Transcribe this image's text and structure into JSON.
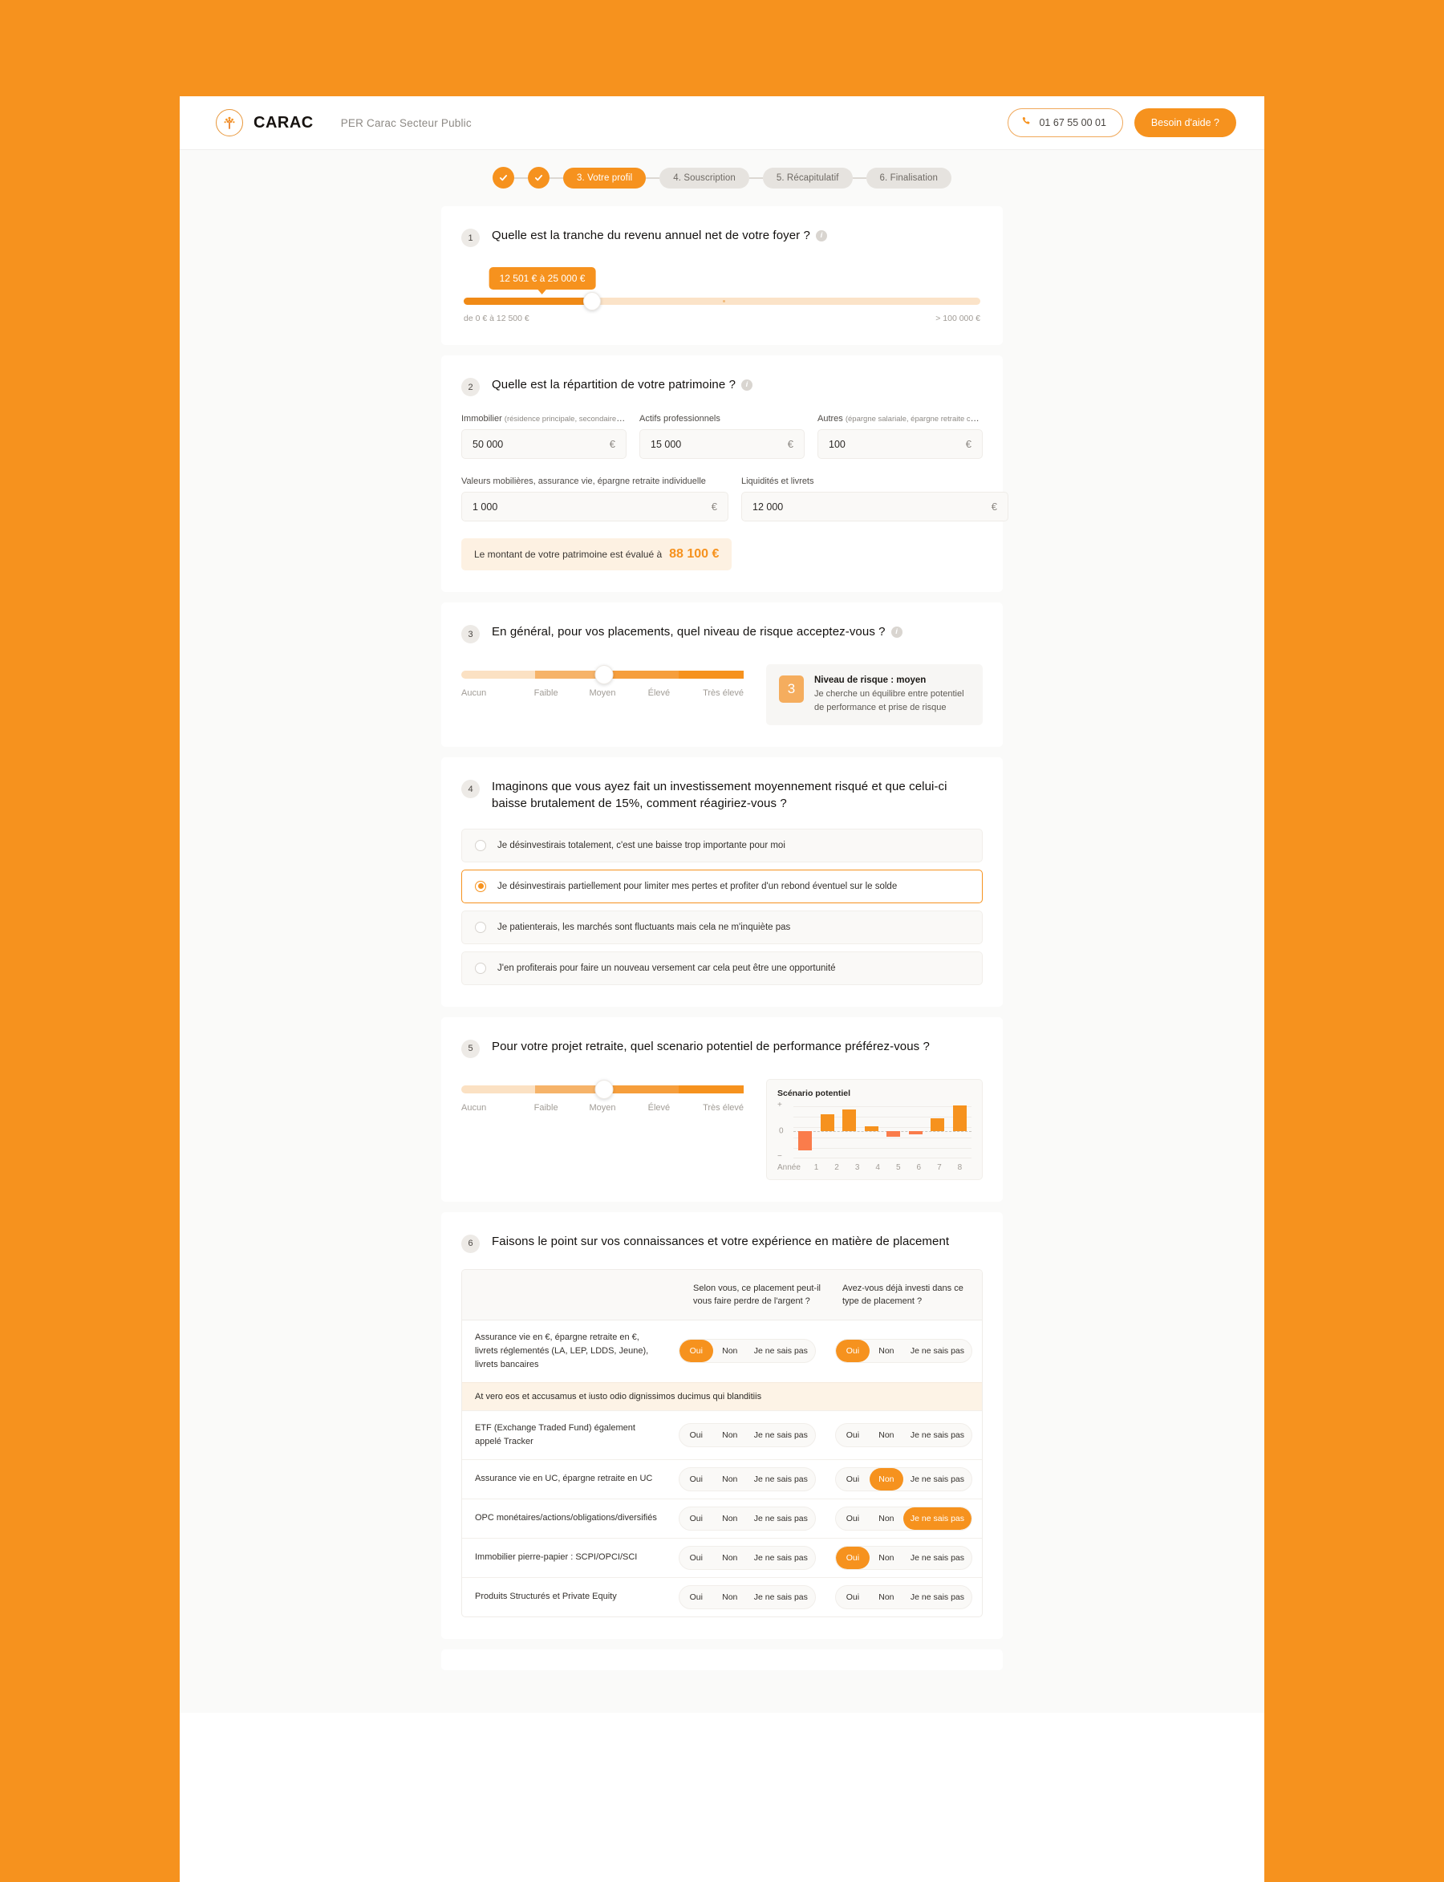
{
  "header": {
    "brand_name": "CARAC",
    "product_name": "PER Carac Secteur Public",
    "phone": "01 67 55 00 01",
    "help_label": "Besoin d'aide ?"
  },
  "stepper": {
    "steps": [
      {
        "label": "",
        "state": "done"
      },
      {
        "label": "",
        "state": "done"
      },
      {
        "label": "3. Votre profil",
        "state": "current"
      },
      {
        "label": "4. Souscription",
        "state": "todo"
      },
      {
        "label": "5. Récapitulatif",
        "state": "todo"
      },
      {
        "label": "6. Finalisation",
        "state": "todo"
      }
    ]
  },
  "q1": {
    "number": "1",
    "text": "Quelle est la tranche du revenu annuel net de votre foyer ?",
    "bubble_value": "12 501 € à 25 000 €",
    "min_label": "de 0 € à 12 500 €",
    "max_label": "> 100 000 €"
  },
  "q2": {
    "number": "2",
    "text": "Quelle est la répartition de votre patrimoine ?",
    "fields": [
      {
        "label": "Immobilier",
        "hint": "(résidence principale, secondaire et locatif)",
        "value": "50 000",
        "unit": "€"
      },
      {
        "label": "Actifs professionnels",
        "hint": "",
        "value": "15 000",
        "unit": "€"
      },
      {
        "label": "Autres",
        "hint": "(épargne salariale, épargne retraite collective...)",
        "value": "100",
        "unit": "€"
      },
      {
        "label": "Valeurs mobilières, assurance vie, épargne retraite individuelle",
        "hint": "",
        "value": "1 000",
        "unit": "€"
      },
      {
        "label": "Liquidités et livrets",
        "hint": "",
        "value": "12 000",
        "unit": "€"
      }
    ],
    "total_prefix": "Le montant de votre patrimoine est évalué à",
    "total_amount": "88 100 €"
  },
  "q3": {
    "number": "3",
    "text": "En général, pour vos placements, quel niveau de risque acceptez-vous ?",
    "scale": [
      "Aucun",
      "Faible",
      "Moyen",
      "Élevé",
      "Très élevé"
    ],
    "badge": "3",
    "info_title": "Niveau de risque : moyen",
    "info_desc": "Je cherche un équilibre entre potentiel de performance et prise de risque"
  },
  "q4": {
    "number": "4",
    "text": "Imaginons que vous ayez fait un investissement moyennement risqué et que celui-ci baisse brutalement de 15%, comment réagiriez-vous ?",
    "options": [
      {
        "label": "Je désinvestirais totalement, c'est une baisse trop importante pour moi",
        "selected": false
      },
      {
        "label": "Je désinvestirais partiellement pour limiter mes pertes et profiter d'un rebond éventuel sur le solde",
        "selected": true
      },
      {
        "label": "Je patienterais, les marchés sont fluctuants mais cela ne m'inquiète pas",
        "selected": false
      },
      {
        "label": "J'en profiterais pour faire un nouveau versement car cela peut être une opportunité",
        "selected": false
      }
    ]
  },
  "q5": {
    "number": "5",
    "text": "Pour votre projet retraite, quel scenario potentiel de performance préférez-vous ?",
    "scale": [
      "Aucun",
      "Faible",
      "Moyen",
      "Élevé",
      "Très élevé"
    ]
  },
  "chart_data": {
    "type": "bar",
    "title": "Scénario potentiel",
    "xlabel": "Année",
    "ylabel": "",
    "categories": [
      "1",
      "2",
      "3",
      "4",
      "5",
      "6",
      "7",
      "8"
    ],
    "values": [
      -28,
      24,
      31,
      7,
      -8,
      -4,
      18,
      37
    ],
    "ylim": [
      -35,
      40
    ],
    "ytick_labels": [
      "+",
      "0",
      "−"
    ],
    "grid": true,
    "legend": "none",
    "colors": {
      "positive": "#F6921E",
      "negative": "#FA7C4B"
    }
  },
  "q6": {
    "number": "6",
    "text": "Faisons le point sur vos connaissances et votre expérience en matière de placement",
    "col1_header": "Selon vous, ce placement peut-il vous faire perdre de l'argent ?",
    "col2_header": "Avez-vous déjà investi dans ce type de placement ?",
    "choices": [
      "Oui",
      "Non",
      "Je ne sais pas"
    ],
    "note": "At vero eos et accusamus et iusto odio dignissimos ducimus qui blanditiis",
    "rows": [
      {
        "label": "Assurance vie en €, épargne retraite en €, livrets réglementés (LA, LEP, LDDS, Jeune), livrets bancaires",
        "col1_selected": "Oui",
        "col2_selected": "Oui",
        "has_note": true
      },
      {
        "label": "ETF (Exchange Traded Fund) également appelé Tracker",
        "col1_selected": "",
        "col2_selected": "",
        "has_note": false
      },
      {
        "label": "Assurance vie en UC, épargne retraite en UC",
        "col1_selected": "",
        "col2_selected": "Non",
        "has_note": false
      },
      {
        "label": "OPC monétaires/actions/obligations/diversifiés",
        "col1_selected": "",
        "col2_selected": "Je ne sais pas",
        "has_note": false
      },
      {
        "label": "Immobilier pierre-papier : SCPI/OPCI/SCI",
        "col1_selected": "",
        "col2_selected": "Oui",
        "has_note": false
      },
      {
        "label": "Produits Structurés et Private Equity",
        "col1_selected": "",
        "col2_selected": "",
        "has_note": false
      }
    ]
  },
  "colors": {
    "brand_orange": "#F6921E",
    "page_bg": "#FAFAF9",
    "negative_bar": "#FA7C4B"
  }
}
